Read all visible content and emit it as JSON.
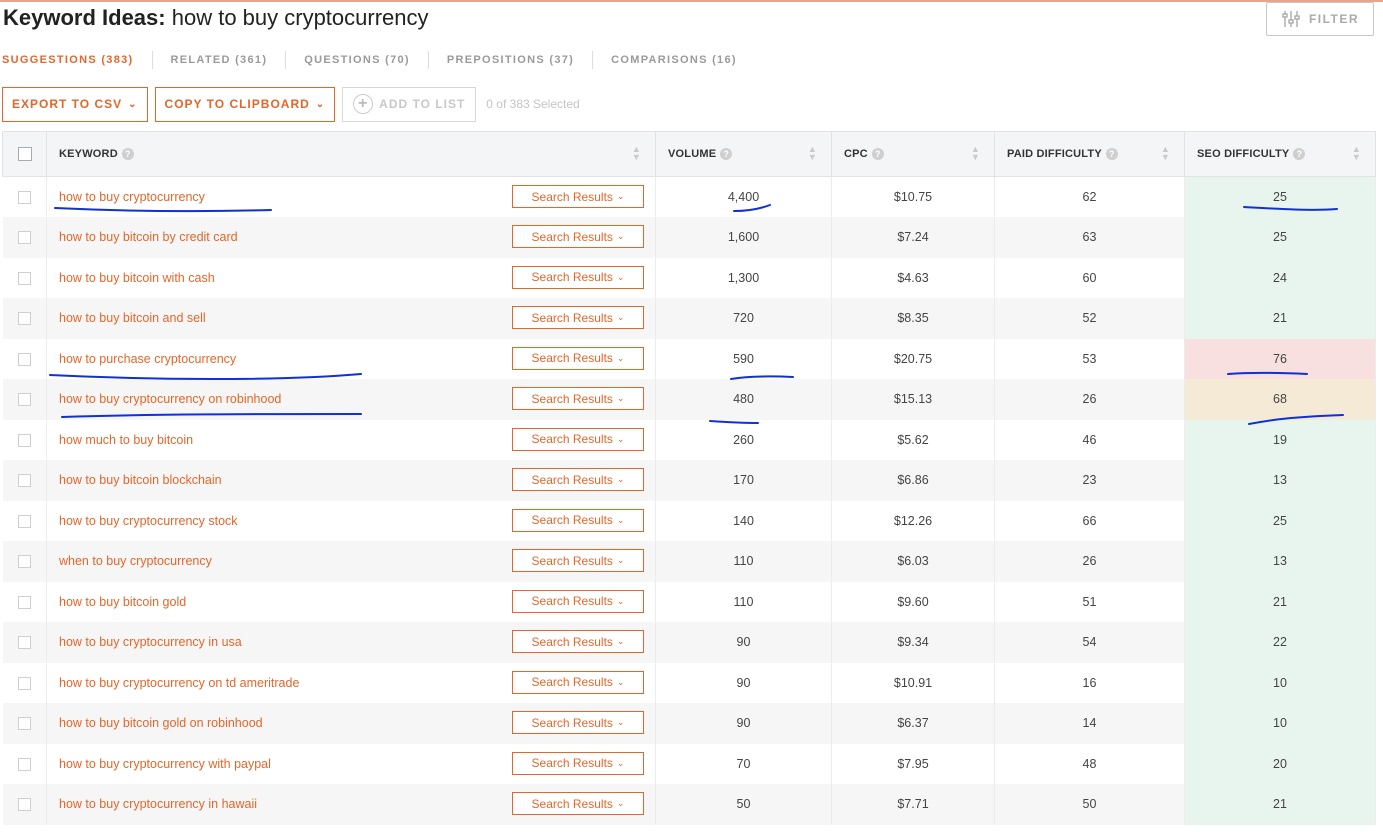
{
  "header": {
    "title_prefix": "Keyword Ideas:",
    "title_query": "how to buy cryptocurrency",
    "filter_label": "FILTER"
  },
  "tabs": [
    {
      "label": "SUGGESTIONS (383)",
      "active": true
    },
    {
      "label": "RELATED (361)",
      "active": false
    },
    {
      "label": "QUESTIONS (70)",
      "active": false
    },
    {
      "label": "PREPOSITIONS (37)",
      "active": false
    },
    {
      "label": "COMPARISONS (16)",
      "active": false
    }
  ],
  "actions": {
    "export_label": "EXPORT TO CSV",
    "copy_label": "COPY TO CLIPBOARD",
    "add_label": "ADD TO LIST",
    "selected_text": "0 of 383 Selected"
  },
  "columns": {
    "keyword": "KEYWORD",
    "volume": "VOLUME",
    "cpc": "CPC",
    "paid": "PAID DIFFICULTY",
    "seo": "SEO DIFFICULTY"
  },
  "search_results_label": "Search Results",
  "rows": [
    {
      "keyword": "how to buy cryptocurrency",
      "volume": "4,400",
      "cpc": "$10.75",
      "paid": "62",
      "seo": "25",
      "seo_level": "green"
    },
    {
      "keyword": "how to buy bitcoin by credit card",
      "volume": "1,600",
      "cpc": "$7.24",
      "paid": "63",
      "seo": "25",
      "seo_level": "green"
    },
    {
      "keyword": "how to buy bitcoin with cash",
      "volume": "1,300",
      "cpc": "$4.63",
      "paid": "60",
      "seo": "24",
      "seo_level": "green"
    },
    {
      "keyword": "how to buy bitcoin and sell",
      "volume": "720",
      "cpc": "$8.35",
      "paid": "52",
      "seo": "21",
      "seo_level": "green"
    },
    {
      "keyword": "how to purchase cryptocurrency",
      "volume": "590",
      "cpc": "$20.75",
      "paid": "53",
      "seo": "76",
      "seo_level": "red"
    },
    {
      "keyword": "how to buy cryptocurrency on robinhood",
      "volume": "480",
      "cpc": "$15.13",
      "paid": "26",
      "seo": "68",
      "seo_level": "tan"
    },
    {
      "keyword": "how much to buy bitcoin",
      "volume": "260",
      "cpc": "$5.62",
      "paid": "46",
      "seo": "19",
      "seo_level": "green"
    },
    {
      "keyword": "how to buy bitcoin blockchain",
      "volume": "170",
      "cpc": "$6.86",
      "paid": "23",
      "seo": "13",
      "seo_level": "green"
    },
    {
      "keyword": "how to buy cryptocurrency stock",
      "volume": "140",
      "cpc": "$12.26",
      "paid": "66",
      "seo": "25",
      "seo_level": "green"
    },
    {
      "keyword": "when to buy cryptocurrency",
      "volume": "110",
      "cpc": "$6.03",
      "paid": "26",
      "seo": "13",
      "seo_level": "green"
    },
    {
      "keyword": "how to buy bitcoin gold",
      "volume": "110",
      "cpc": "$9.60",
      "paid": "51",
      "seo": "21",
      "seo_level": "green"
    },
    {
      "keyword": "how to buy cryptocurrency in usa",
      "volume": "90",
      "cpc": "$9.34",
      "paid": "54",
      "seo": "22",
      "seo_level": "green"
    },
    {
      "keyword": "how to buy cryptocurrency on td ameritrade",
      "volume": "90",
      "cpc": "$10.91",
      "paid": "16",
      "seo": "10",
      "seo_level": "green"
    },
    {
      "keyword": "how to buy bitcoin gold on robinhood",
      "volume": "90",
      "cpc": "$6.37",
      "paid": "14",
      "seo": "10",
      "seo_level": "green"
    },
    {
      "keyword": "how to buy cryptocurrency with paypal",
      "volume": "70",
      "cpc": "$7.95",
      "paid": "48",
      "seo": "20",
      "seo_level": "green"
    },
    {
      "keyword": "how to buy cryptocurrency in hawaii",
      "volume": "50",
      "cpc": "$7.71",
      "paid": "50",
      "seo": "21",
      "seo_level": "green"
    }
  ],
  "colors": {
    "accent": "#e4662a",
    "seo_green": "#e8f5ee",
    "seo_red": "#f8e0e0",
    "seo_tan": "#f4ead6",
    "annotation_ink": "#1030d8"
  }
}
